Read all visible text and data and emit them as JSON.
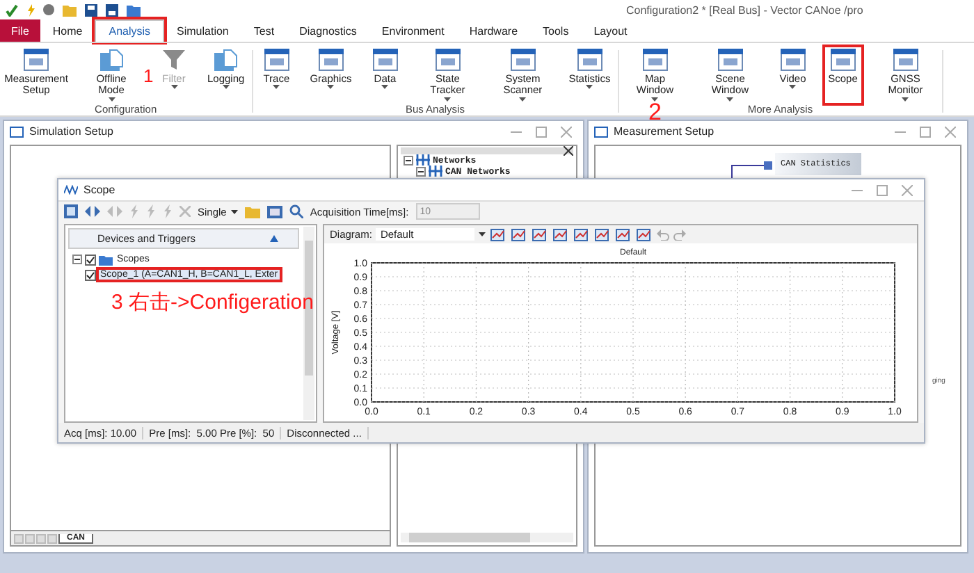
{
  "title_bar": {
    "title": "Configuration2 * [Real Bus] - Vector CANoe /pro"
  },
  "menu_tabs": [
    {
      "label": "File",
      "kind": "file",
      "selected": false,
      "annotated": false
    },
    {
      "label": "Home",
      "kind": "tab",
      "selected": false,
      "annotated": false
    },
    {
      "label": "Analysis",
      "kind": "tab",
      "selected": true,
      "annotated": true
    },
    {
      "label": "Simulation",
      "kind": "tab",
      "selected": false,
      "annotated": false
    },
    {
      "label": "Test",
      "kind": "tab",
      "selected": false,
      "annotated": false
    },
    {
      "label": "Diagnostics",
      "kind": "tab",
      "selected": false,
      "annotated": false
    },
    {
      "label": "Environment",
      "kind": "tab",
      "selected": false,
      "annotated": false
    },
    {
      "label": "Hardware",
      "kind": "tab",
      "selected": false,
      "annotated": false
    },
    {
      "label": "Tools",
      "kind": "tab",
      "selected": false,
      "annotated": false
    },
    {
      "label": "Layout",
      "kind": "tab",
      "selected": false,
      "annotated": false
    }
  ],
  "ribbon_groups": [
    {
      "label": "Configuration",
      "buttons": [
        {
          "label": "Measurement Setup",
          "kind": "window",
          "dropdown": false,
          "disabled": false,
          "annotated": false
        },
        {
          "label": "Offline Mode",
          "kind": "folder",
          "dropdown": true,
          "disabled": false,
          "annotated": false
        },
        {
          "label": "Filter",
          "kind": "funnel",
          "dropdown": true,
          "disabled": true,
          "annotated": false
        },
        {
          "label": "Logging",
          "kind": "folder",
          "dropdown": true,
          "disabled": false,
          "annotated": false
        }
      ]
    },
    {
      "label": "Bus Analysis",
      "buttons": [
        {
          "label": "Trace",
          "kind": "window",
          "dropdown": true,
          "disabled": false,
          "annotated": false
        },
        {
          "label": "Graphics",
          "kind": "window",
          "dropdown": true,
          "disabled": false,
          "annotated": false
        },
        {
          "label": "Data",
          "kind": "window",
          "dropdown": true,
          "disabled": false,
          "annotated": false
        },
        {
          "label": "State Tracker",
          "kind": "window",
          "dropdown": true,
          "disabled": false,
          "annotated": false
        },
        {
          "label": "System Scanner",
          "kind": "window",
          "dropdown": true,
          "disabled": false,
          "annotated": false
        },
        {
          "label": "Statistics",
          "kind": "window",
          "dropdown": true,
          "disabled": false,
          "annotated": false
        }
      ]
    },
    {
      "label": "More Analysis",
      "buttons": [
        {
          "label": "Map Window",
          "kind": "window",
          "dropdown": true,
          "disabled": false,
          "annotated": false
        },
        {
          "label": "Scene Window",
          "kind": "window",
          "dropdown": true,
          "disabled": false,
          "annotated": false
        },
        {
          "label": "Video",
          "kind": "window",
          "dropdown": true,
          "disabled": false,
          "annotated": false
        },
        {
          "label": "Scope",
          "kind": "window",
          "dropdown": false,
          "disabled": false,
          "annotated": true
        },
        {
          "label": "GNSS Monitor",
          "kind": "window",
          "dropdown": true,
          "disabled": false,
          "annotated": false
        }
      ]
    }
  ],
  "simulation_setup": {
    "title": "Simulation Setup",
    "network_tree": [
      {
        "label": "Networks",
        "expanded": true,
        "children": [
          {
            "label": "CAN Networks",
            "expanded": true
          }
        ]
      }
    ],
    "sheet_tabs": [
      {
        "label": "CAN",
        "selected": true
      }
    ]
  },
  "measurement_setup": {
    "title": "Measurement Setup",
    "block": "CAN Statistics",
    "fragment": "ging"
  },
  "scope": {
    "title": "Scope",
    "toolbar": {
      "mode": "Single",
      "acq_label": "Acquisition Time[ms]:",
      "acq_value": "10"
    },
    "tree": {
      "header": "Devices and Triggers",
      "items": [
        {
          "label": "Scopes",
          "checked": true,
          "expanded": true,
          "annotated": false,
          "children": [
            {
              "label": "Scope_1 (A=CAN1_H, B=CAN1_L, Exter",
              "checked": true,
              "annotated": true
            }
          ]
        }
      ]
    },
    "diagram": {
      "label": "Diagram:",
      "value": "Default",
      "chart_data": {
        "type": "line",
        "grid": true,
        "title": "Default",
        "ylabel": "Voltage [V]",
        "xlim": [
          0,
          1
        ],
        "ylim": [
          0,
          1
        ],
        "xticks": [
          {
            "value": 0,
            "label": "0.0"
          },
          {
            "value": 0.1,
            "label": "0.1"
          },
          {
            "value": 0.2,
            "label": "0.2"
          },
          {
            "value": 0.3,
            "label": "0.3"
          },
          {
            "value": 0.4,
            "label": "0.4"
          },
          {
            "value": 0.5,
            "label": "0.5"
          },
          {
            "value": 0.6,
            "label": "0.6"
          },
          {
            "value": 0.7,
            "label": "0.7"
          },
          {
            "value": 0.8,
            "label": "0.8"
          },
          {
            "value": 0.9,
            "label": "0.9"
          },
          {
            "value": 1,
            "label": "1.0"
          }
        ],
        "yticks": [
          {
            "value": 0,
            "label": "0.0"
          },
          {
            "value": 0.1,
            "label": "0.1"
          },
          {
            "value": 0.2,
            "label": "0.2"
          },
          {
            "value": 0.3,
            "label": "0.3"
          },
          {
            "value": 0.4,
            "label": "0.4"
          },
          {
            "value": 0.5,
            "label": "0.5"
          },
          {
            "value": 0.6,
            "label": "0.6"
          },
          {
            "value": 0.7,
            "label": "0.7"
          },
          {
            "value": 0.8,
            "label": "0.8"
          },
          {
            "value": 0.9,
            "label": "0.9"
          },
          {
            "value": 1,
            "label": "1.0"
          }
        ]
      }
    },
    "status": [
      "Acq [ms]: 10.00",
      "Pre [ms]:  5.00 Pre [%]:  50",
      "Disconnected ..."
    ]
  },
  "annotations": [
    {
      "text": "1"
    },
    {
      "text": "2"
    },
    {
      "text": "3 右击->Configeration"
    }
  ]
}
